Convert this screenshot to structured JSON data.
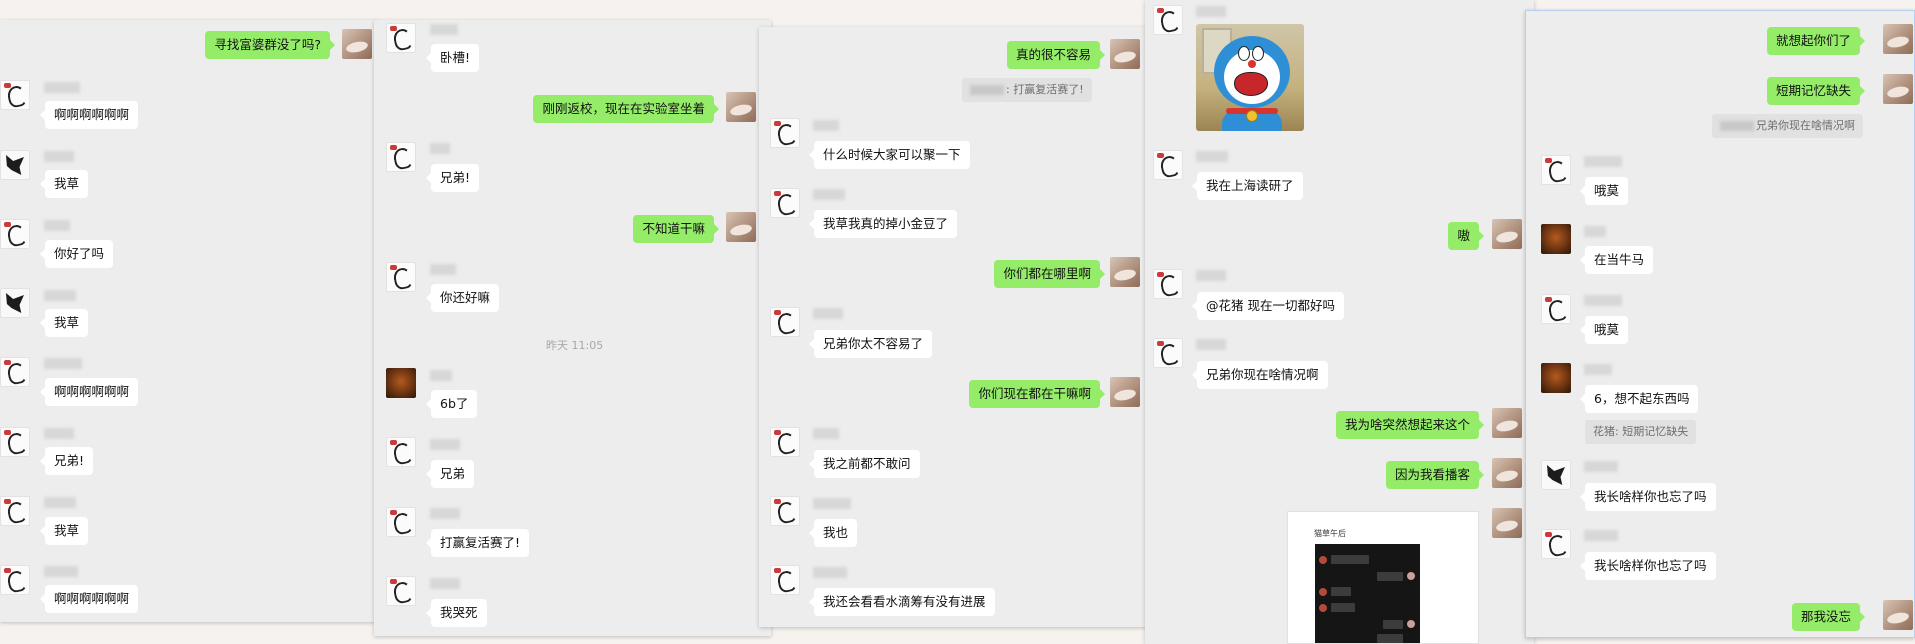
{
  "window1": {
    "left_rows": [
      {
        "text": "寻找富婆群没了吗?",
        "dir": "out"
      },
      {
        "text": "啊啊啊啊啊啊",
        "dir": "in"
      },
      {
        "text": "我草",
        "dir": "in"
      },
      {
        "text": "你好了吗",
        "dir": "in"
      },
      {
        "text": "我草",
        "dir": "in"
      },
      {
        "text": "啊啊啊啊啊啊",
        "dir": "in"
      },
      {
        "text": "兄弟!",
        "dir": "in"
      },
      {
        "text": "我草",
        "dir": "in"
      },
      {
        "text": "啊啊啊啊啊啊",
        "dir": "in"
      }
    ]
  },
  "window2": {
    "rows": [
      {
        "text": "卧槽!",
        "dir": "in"
      },
      {
        "text": "刚刚返校，现在在实验室坐着",
        "dir": "out"
      },
      {
        "text": "兄弟!",
        "dir": "in"
      },
      {
        "text": "不知道干嘛",
        "dir": "out"
      },
      {
        "text": "你还好嘛",
        "dir": "in"
      },
      {
        "text": "6b了",
        "dir": "in"
      },
      {
        "text": "兄弟",
        "dir": "in"
      },
      {
        "text": "打赢复活赛了!",
        "dir": "in"
      },
      {
        "text": "我哭死",
        "dir": "in"
      }
    ],
    "timestamp": "昨天 11:05"
  },
  "window3": {
    "rows": [
      {
        "text": "真的很不容易",
        "dir": "out"
      },
      {
        "text": "什么时候大家可以聚一下",
        "dir": "in"
      },
      {
        "text": "我草我真的掉小金豆了",
        "dir": "in"
      },
      {
        "text": "你们都在哪里啊",
        "dir": "out"
      },
      {
        "text": "兄弟你太不容易了",
        "dir": "in"
      },
      {
        "text": "你们现在都在干嘛啊",
        "dir": "out"
      },
      {
        "text": "我之前都不敢问",
        "dir": "in"
      },
      {
        "text": "我也",
        "dir": "in"
      },
      {
        "text": "我还会看看水滴筹有没有进展",
        "dir": "in"
      }
    ],
    "quote": ": 打赢复活赛了!"
  },
  "window4": {
    "rows": [
      {
        "text": "我在上海读研了",
        "dir": "in"
      },
      {
        "text": "嗷",
        "dir": "out"
      },
      {
        "text": "@花猪 现在一切都好吗",
        "dir": "in"
      },
      {
        "text": "兄弟你现在啥情况啊",
        "dir": "in"
      },
      {
        "text": "我为啥突然想起来这个",
        "dir": "out"
      },
      {
        "text": "因为我看播客",
        "dir": "out"
      }
    ],
    "sticker_icon": "doraemon-crying-sticker",
    "shared_image_title": "猫草午后"
  },
  "window5": {
    "rows": [
      {
        "text": "就想起你们了",
        "dir": "out"
      },
      {
        "text": "短期记忆缺失",
        "dir": "out"
      },
      {
        "text": "哦莫",
        "dir": "in"
      },
      {
        "text": "在当牛马",
        "dir": "in"
      },
      {
        "text": "哦莫",
        "dir": "in"
      },
      {
        "text": "6，想不起东西吗",
        "dir": "in"
      },
      {
        "text": "我长啥样你也忘了吗",
        "dir": "in"
      },
      {
        "text": "我长啥样你也忘了吗",
        "dir": "in"
      },
      {
        "text": "那我没忘",
        "dir": "out"
      }
    ],
    "quote1": "兄弟你现在啥情况啊",
    "quote2": "花猪: 短期记忆缺失"
  },
  "colors": {
    "out_bubble": "#95ec69",
    "in_bubble": "#ffffff",
    "chat_bg": "#ededed"
  }
}
